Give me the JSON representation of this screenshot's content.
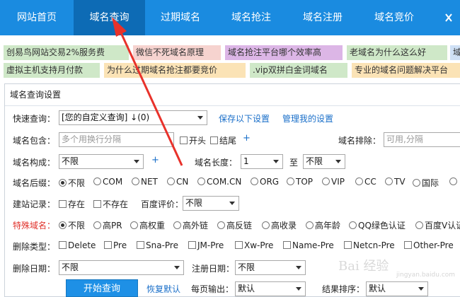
{
  "nav": {
    "items": [
      "网站首页",
      "域名查询",
      "过期域名",
      "域名抢注",
      "域名注册",
      "域名竞价"
    ],
    "active_index": 1,
    "colors": {
      "bar": "#1a8be0",
      "active": "#0d6bb5"
    }
  },
  "tags": {
    "row1": [
      "创易鸟网站交易2%服务费",
      "微信不死域名原理",
      "域名抢注平台哪个效率高",
      "老域名为什么这么好",
      "域"
    ],
    "row2": [
      "虚拟主机支持月付款",
      "为什么过期域名抢注都要竞价",
      ".vip双拼白金词域名",
      "专业的域名问题解决平台"
    ]
  },
  "panel": {
    "title": "域名查询设置",
    "quick_query": {
      "label": "快速查询：",
      "value": "[您的自定义查询] ↓(0)",
      "save_link": "保存以下设置",
      "manage_link": "管理我的设置"
    },
    "contains": {
      "label": "域名包含：",
      "placeholder": "多个用换行分隔",
      "opt_start": "开头",
      "opt_end": "结尾",
      "plus": "+"
    },
    "exclude": {
      "label": "域名排除：",
      "placeholder": "可用,分隔"
    },
    "structure": {
      "label": "域名构成：",
      "value": "不限",
      "plus": "+"
    },
    "length": {
      "label": "域名长度：",
      "from": "1",
      "to_label": "至",
      "to": "不限"
    },
    "suffix": {
      "label": "域名后缀：",
      "options": [
        "不限",
        "COM",
        "NET",
        "CN",
        "COM.CN",
        "ORG",
        "TOP",
        "VIP",
        "CC",
        "TV",
        "国际"
      ],
      "selected": 0
    },
    "record": {
      "label": "建站记录：",
      "opt_exists": "存在",
      "opt_not_exists": "不存在",
      "baidu_label": "百度评价：",
      "baidu_value": "不限"
    },
    "special": {
      "label": "特殊域名：",
      "options": [
        "不限",
        "高PR",
        "高权重",
        "高外链",
        "高反链",
        "高收录",
        "高年龄",
        "QQ绿色认证",
        "百度V认证"
      ],
      "selected": 0
    },
    "delete_type": {
      "label": "删除类型：",
      "options": [
        "Delete",
        "Pre",
        "Sna-Pre",
        "JM-Pre",
        "Xw-Pre",
        "Name-Pre",
        "Netcn-Pre",
        "Other-Pre"
      ]
    },
    "delete_date": {
      "label": "删除日期：",
      "value": "不限",
      "reg_label": "注册日期：",
      "reg_value": "不限"
    },
    "actions": {
      "search_button": "开始查询",
      "reset_link": "恢复默认",
      "per_page_label": "每页输出：",
      "per_page_value": "默认",
      "sort_label": "结果排序：",
      "sort_value": "默认"
    }
  },
  "watermark": {
    "text": "Bai 经验",
    "sub": "jingyan.baidu.com"
  }
}
